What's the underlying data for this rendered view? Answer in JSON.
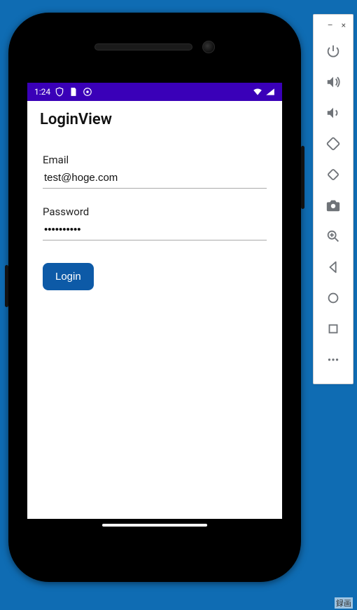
{
  "emulator": {
    "minimize": "–",
    "close": "×"
  },
  "statusbar": {
    "time": "1:24"
  },
  "app": {
    "title": "LoginView",
    "email_label": "Email",
    "email_value": "test@hoge.com",
    "password_label": "Password",
    "password_value": "password12",
    "login_label": "Login"
  },
  "misc": {
    "recording_label": "録画"
  }
}
